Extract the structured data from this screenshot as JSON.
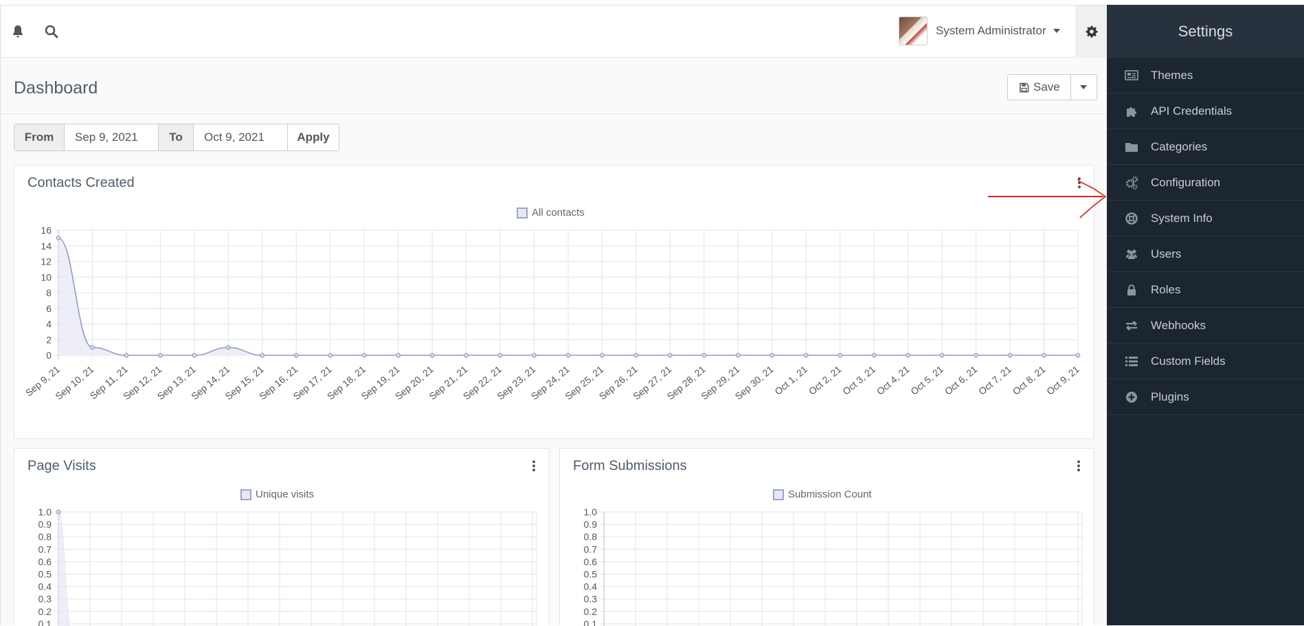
{
  "topbar": {
    "notification_icon": "bell-icon",
    "search_icon": "search-icon",
    "user_name": "System Administrator",
    "settings_icon": "gear-icon"
  },
  "header": {
    "title": "Dashboard",
    "save_label": "Save"
  },
  "date_filter": {
    "from_label": "From",
    "from_value": "Sep 9, 2021",
    "to_label": "To",
    "to_value": "Oct 9, 2021",
    "apply_label": "Apply"
  },
  "sidebar": {
    "title": "Settings",
    "items": [
      {
        "label": "Themes",
        "icon": "newspaper-icon"
      },
      {
        "label": "API Credentials",
        "icon": "puzzle-icon"
      },
      {
        "label": "Categories",
        "icon": "folder-icon"
      },
      {
        "label": "Configuration",
        "icon": "gears-icon"
      },
      {
        "label": "System Info",
        "icon": "life-ring-icon"
      },
      {
        "label": "Users",
        "icon": "users-icon"
      },
      {
        "label": "Roles",
        "icon": "lock-icon"
      },
      {
        "label": "Webhooks",
        "icon": "exchange-icon"
      },
      {
        "label": "Custom Fields",
        "icon": "list-icon"
      },
      {
        "label": "Plugins",
        "icon": "plus-circle-icon"
      }
    ]
  },
  "colors": {
    "series_line": "#8f9cc9",
    "series_fill": "#e8eaf5",
    "sidebar_bg": "#1c2631",
    "annotation": "#e02020"
  },
  "panels": {
    "contacts": {
      "title": "Contacts Created"
    },
    "visits": {
      "title": "Page Visits"
    },
    "forms": {
      "title": "Form Submissions"
    }
  },
  "chart_data": [
    {
      "type": "area",
      "title": "Contacts Created",
      "series": [
        {
          "name": "All contacts",
          "values": [
            15,
            1,
            0,
            0,
            0,
            1,
            0,
            0,
            0,
            0,
            0,
            0,
            0,
            0,
            0,
            0,
            0,
            0,
            0,
            0,
            0,
            0,
            0,
            0,
            0,
            0,
            0,
            0,
            0,
            0,
            0
          ]
        }
      ],
      "x": [
        "Sep 9, 21",
        "Sep 10, 21",
        "Sep 11, 21",
        "Sep 12, 21",
        "Sep 13, 21",
        "Sep 14, 21",
        "Sep 15, 21",
        "Sep 16, 21",
        "Sep 17, 21",
        "Sep 18, 21",
        "Sep 19, 21",
        "Sep 20, 21",
        "Sep 21, 21",
        "Sep 22, 21",
        "Sep 23, 21",
        "Sep 24, 21",
        "Sep 25, 21",
        "Sep 26, 21",
        "Sep 27, 21",
        "Sep 28, 21",
        "Sep 29, 21",
        "Sep 30, 21",
        "Oct 1, 21",
        "Oct 2, 21",
        "Oct 3, 21",
        "Oct 4, 21",
        "Oct 5, 21",
        "Oct 6, 21",
        "Oct 7, 21",
        "Oct 8, 21",
        "Oct 9, 21"
      ],
      "yticks": [
        "16",
        "14",
        "12",
        "10",
        "8",
        "6",
        "4",
        "2",
        "0"
      ],
      "ylim": [
        0,
        16
      ],
      "grid": true,
      "legend": "top-center"
    },
    {
      "type": "area",
      "title": "Page Visits",
      "series": [
        {
          "name": "Unique visits",
          "values": [
            1.0,
            0.0
          ]
        }
      ],
      "yticks": [
        "1.0",
        "0.9",
        "0.8",
        "0.7",
        "0.6",
        "0.5",
        "0.4",
        "0.3",
        "0.2",
        "0.1"
      ],
      "ylim": [
        0,
        1
      ],
      "grid": true,
      "legend": "top-center"
    },
    {
      "type": "area",
      "title": "Form Submissions",
      "series": [
        {
          "name": "Submission Count",
          "values": []
        }
      ],
      "yticks": [
        "1.0",
        "0.9",
        "0.8",
        "0.7",
        "0.6",
        "0.5",
        "0.4",
        "0.3",
        "0.2",
        "0.1"
      ],
      "ylim": [
        0,
        1
      ],
      "grid": true,
      "legend": "top-center"
    }
  ]
}
